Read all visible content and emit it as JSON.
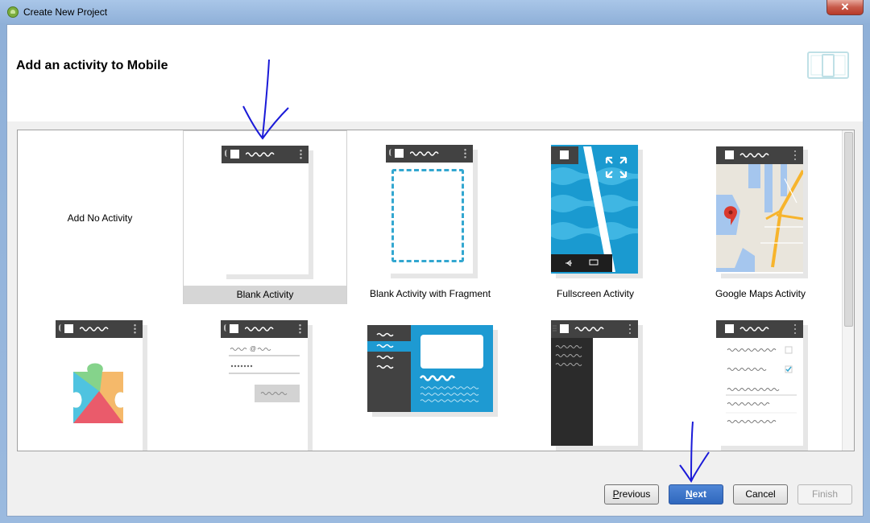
{
  "window": {
    "title": "Create New Project",
    "close_glyph": "✕"
  },
  "header": {
    "title": "Add an activity to Mobile",
    "icon": "mobile-device-icon"
  },
  "gallery": {
    "selected": "Blank Activity",
    "tiles": [
      {
        "label": "Add No Activity"
      },
      {
        "label": "Blank Activity"
      },
      {
        "label": "Blank Activity with Fragment"
      },
      {
        "label": "Fullscreen Activity"
      },
      {
        "label": "Google Maps Activity"
      },
      {
        "label": ""
      },
      {
        "label": ""
      },
      {
        "label": ""
      },
      {
        "label": ""
      },
      {
        "label": ""
      }
    ]
  },
  "buttons": {
    "previous": {
      "mnemonic": "P",
      "rest": "revious"
    },
    "next": {
      "mnemonic": "N",
      "rest": "ext"
    },
    "cancel": "Cancel",
    "finish": "Finish"
  },
  "colors": {
    "accent": "#33a7d0",
    "primary_button": "#3a72c8",
    "annotation_arrow": "#1a1ad8"
  }
}
